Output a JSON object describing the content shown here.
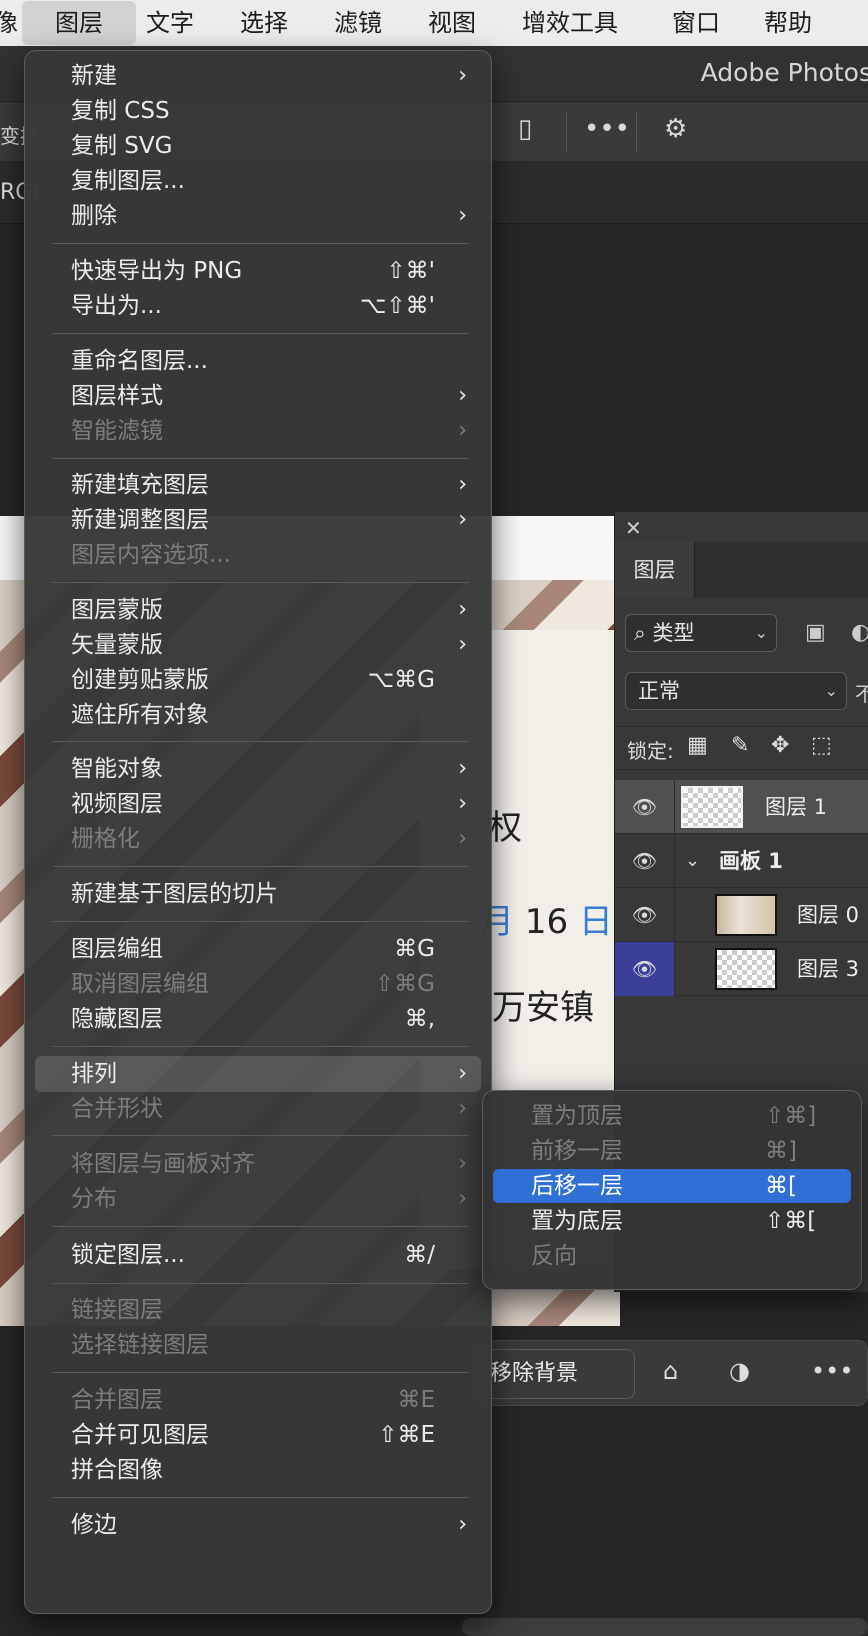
{
  "menubar": {
    "items": [
      "像",
      "图层",
      "文字",
      "选择",
      "滤镜",
      "视图",
      "增效工具",
      "窗口",
      "帮助"
    ],
    "active_index": 1
  },
  "app": {
    "title": "Adobe Photos",
    "options_left_cut": "变换",
    "doc_tab_cut": "RGI"
  },
  "canvas_text": {
    "line1": "权",
    "line2_month": "月",
    "line2_day": "16",
    "line2_unit": "日",
    "line3": "万安镇"
  },
  "layers_panel": {
    "close_glyph": "✕",
    "tab_label": "图层",
    "filter_label": "类型",
    "blend_mode": "正常",
    "opacity_cut": "不",
    "lock_label": "锁定:",
    "layers": [
      {
        "name": "图层 1",
        "selected": true
      },
      {
        "name": "画板 1",
        "is_group": true
      },
      {
        "name": "图层 0"
      },
      {
        "name": "图层 3"
      }
    ]
  },
  "taskbar": {
    "remove_bg_label": "移除背景"
  },
  "main_menu": {
    "items": [
      {
        "label": "新建",
        "shortcut": "",
        "submenu": true,
        "disabled": false
      },
      {
        "label": "复制 CSS",
        "shortcut": "",
        "submenu": false,
        "disabled": false
      },
      {
        "label": "复制 SVG",
        "shortcut": "",
        "submenu": false,
        "disabled": false
      },
      {
        "label": "复制图层...",
        "shortcut": "",
        "submenu": false,
        "disabled": false
      },
      {
        "label": "删除",
        "shortcut": "",
        "submenu": true,
        "disabled": false
      },
      {
        "label": "快速导出为 PNG",
        "shortcut": "⇧⌘'",
        "submenu": false,
        "disabled": false
      },
      {
        "label": "导出为...",
        "shortcut": "⌥⇧⌘'",
        "submenu": false,
        "disabled": false
      },
      {
        "label": "重命名图层...",
        "shortcut": "",
        "submenu": false,
        "disabled": false
      },
      {
        "label": "图层样式",
        "shortcut": "",
        "submenu": true,
        "disabled": false
      },
      {
        "label": "智能滤镜",
        "shortcut": "",
        "submenu": true,
        "disabled": true
      },
      {
        "label": "新建填充图层",
        "shortcut": "",
        "submenu": true,
        "disabled": false
      },
      {
        "label": "新建调整图层",
        "shortcut": "",
        "submenu": true,
        "disabled": false
      },
      {
        "label": "图层内容选项...",
        "shortcut": "",
        "submenu": false,
        "disabled": true
      },
      {
        "label": "图层蒙版",
        "shortcut": "",
        "submenu": true,
        "disabled": false
      },
      {
        "label": "矢量蒙版",
        "shortcut": "",
        "submenu": true,
        "disabled": false
      },
      {
        "label": "创建剪贴蒙版",
        "shortcut": "⌥⌘G",
        "submenu": false,
        "disabled": false
      },
      {
        "label": "遮住所有对象",
        "shortcut": "",
        "submenu": false,
        "disabled": false
      },
      {
        "label": "智能对象",
        "shortcut": "",
        "submenu": true,
        "disabled": false
      },
      {
        "label": "视频图层",
        "shortcut": "",
        "submenu": true,
        "disabled": false
      },
      {
        "label": "栅格化",
        "shortcut": "",
        "submenu": true,
        "disabled": true
      },
      {
        "label": "新建基于图层的切片",
        "shortcut": "",
        "submenu": false,
        "disabled": false
      },
      {
        "label": "图层编组",
        "shortcut": "⌘G",
        "submenu": false,
        "disabled": false
      },
      {
        "label": "取消图层编组",
        "shortcut": "⇧⌘G",
        "submenu": false,
        "disabled": true
      },
      {
        "label": "隐藏图层",
        "shortcut": "⌘,",
        "submenu": false,
        "disabled": false
      },
      {
        "label": "排列",
        "shortcut": "",
        "submenu": true,
        "disabled": false,
        "highlight": true
      },
      {
        "label": "合并形状",
        "shortcut": "",
        "submenu": true,
        "disabled": true
      },
      {
        "label": "将图层与画板对齐",
        "shortcut": "",
        "submenu": true,
        "disabled": true
      },
      {
        "label": "分布",
        "shortcut": "",
        "submenu": true,
        "disabled": true
      },
      {
        "label": "锁定图层...",
        "shortcut": "⌘/",
        "submenu": false,
        "disabled": false
      },
      {
        "label": "链接图层",
        "shortcut": "",
        "submenu": false,
        "disabled": true
      },
      {
        "label": "选择链接图层",
        "shortcut": "",
        "submenu": false,
        "disabled": true
      },
      {
        "label": "合并图层",
        "shortcut": "⌘E",
        "submenu": false,
        "disabled": true
      },
      {
        "label": "合并可见图层",
        "shortcut": "⇧⌘E",
        "submenu": false,
        "disabled": false
      },
      {
        "label": "拼合图像",
        "shortcut": "",
        "submenu": false,
        "disabled": false
      },
      {
        "label": "修边",
        "shortcut": "",
        "submenu": true,
        "disabled": false
      }
    ]
  },
  "arrange_submenu": {
    "items": [
      {
        "label": "置为顶层",
        "shortcut": "⇧⌘]",
        "disabled": true
      },
      {
        "label": "前移一层",
        "shortcut": "⌘]",
        "disabled": true
      },
      {
        "label": "后移一层",
        "shortcut": "⌘[",
        "disabled": false,
        "selected": true
      },
      {
        "label": "置为底层",
        "shortcut": "⇧⌘[",
        "disabled": false
      },
      {
        "label": "反向",
        "shortcut": "",
        "disabled": true
      }
    ]
  }
}
